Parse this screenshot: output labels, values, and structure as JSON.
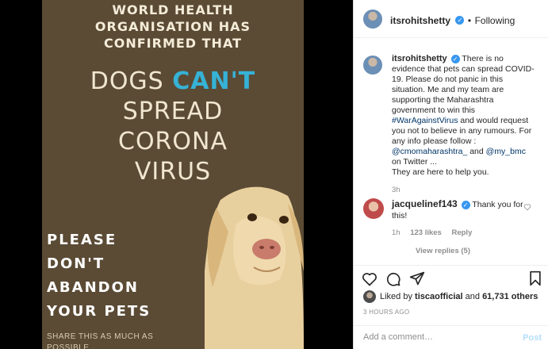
{
  "image": {
    "who_line1": "WORLD HEALTH",
    "who_line2": "ORGANISATION HAS",
    "who_line3": "CONFIRMED THAT",
    "headline_part1": "DOGS ",
    "headline_cant": "CAN'T",
    "headline_line2": "SPREAD",
    "headline_line3": "CORONA",
    "headline_line4": "VIRUS",
    "please_line1": "PLEASE",
    "please_line2": "DON'T",
    "please_line3": "ABANDON",
    "please_line4": "YOUR PETS",
    "share_line1": "SHARE THIS AS MUCH AS",
    "share_line2": "POSSIBLE",
    "colors": {
      "background": "#5b4b35",
      "accent": "#36b2d6",
      "text": "#f1e6cf"
    }
  },
  "header": {
    "username": "itsrohitshetty",
    "separator": "•",
    "follow_status": "Following"
  },
  "caption": {
    "username": "itsrohitshetty",
    "text_1": "There is no evidence that pets can spread COVID-19. Please do not panic in this situation. Me and my team are supporting the Maharashtra government to win this",
    "hashtag": "#WarAgainstVirus",
    "text_2": "and would request you not to believe in any rumours. For any info please follow :",
    "mention_1": "@cmomaharashtra_",
    "text_and": "and",
    "mention_2": "@my_bmc",
    "text_3": "on Twitter ...",
    "text_4": "They are here to help you.",
    "time": "3h"
  },
  "comment": {
    "username": "jacquelinef143",
    "text": "Thank you for this!",
    "time": "1h",
    "likes": "123 likes",
    "reply": "Reply",
    "view_replies": "View replies (5)"
  },
  "likes": {
    "prefix": "Liked by",
    "user": "tiscaofficial",
    "and": "and",
    "others": "61,731 others"
  },
  "timestamp": "3 HOURS AGO",
  "add_comment": {
    "placeholder": "Add a comment…",
    "post_label": "Post"
  },
  "icons": [
    "verified-badge-icon",
    "heart-icon",
    "comment-icon",
    "share-icon",
    "bookmark-icon",
    "small-heart-icon"
  ],
  "colors": {
    "verified": "#3897f0",
    "link": "#003569",
    "muted": "#8e8e8e",
    "post_button": "#b2dffc"
  }
}
